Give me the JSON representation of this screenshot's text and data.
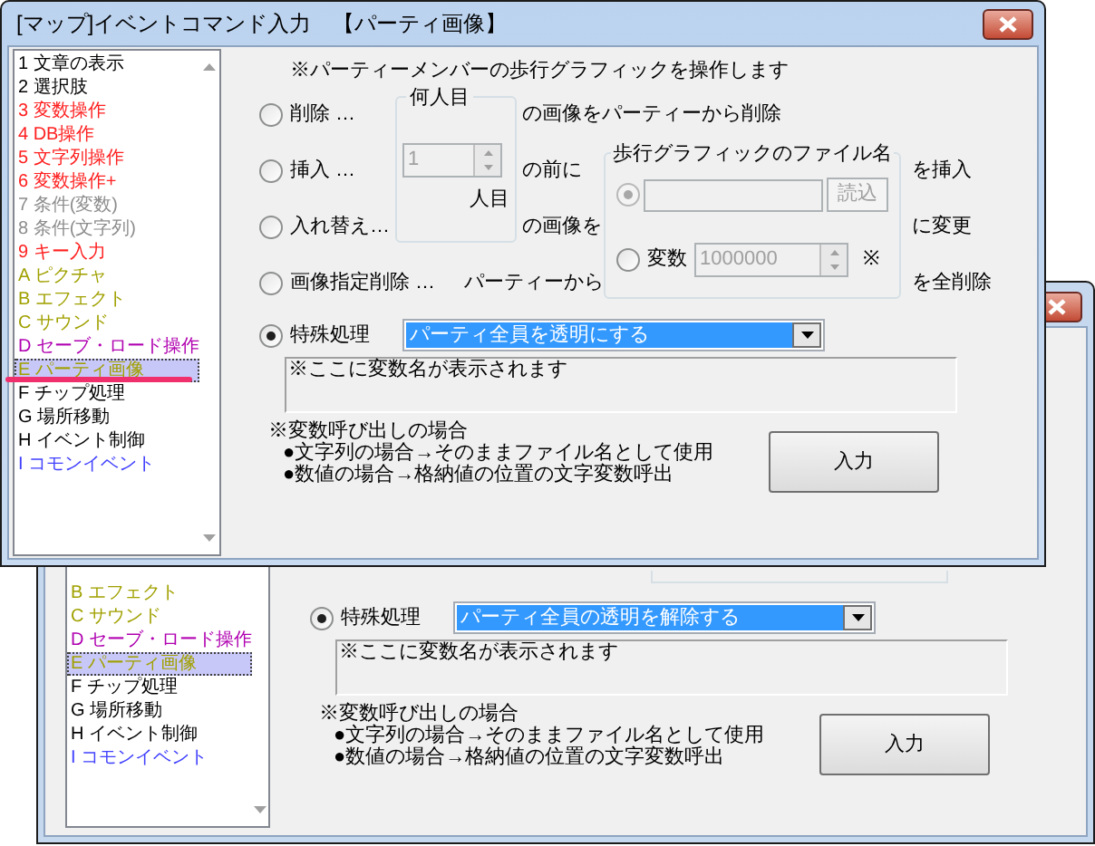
{
  "front_window": {
    "title": "[マップ]イベントコマンド入力　【パーティ画像】",
    "command_list": [
      {
        "label": "1 文章の表示",
        "color": "#000000",
        "selected": false
      },
      {
        "label": "2 選択肢",
        "color": "#000000",
        "selected": false
      },
      {
        "label": "3 変数操作",
        "color": "#ff2020",
        "selected": false
      },
      {
        "label": "4 DB操作",
        "color": "#ff2020",
        "selected": false
      },
      {
        "label": "5 文字列操作",
        "color": "#ff2020",
        "selected": false
      },
      {
        "label": "6 変数操作+",
        "color": "#ff2020",
        "selected": false
      },
      {
        "label": "7 条件(変数)",
        "color": "#8c8c8c",
        "selected": false
      },
      {
        "label": "8 条件(文字列)",
        "color": "#8c8c8c",
        "selected": false
      },
      {
        "label": "9 キー入力",
        "color": "#ff2020",
        "selected": false
      },
      {
        "label": "A ピクチャ",
        "color": "#a0a000",
        "selected": false
      },
      {
        "label": "B エフェクト",
        "color": "#a0a000",
        "selected": false
      },
      {
        "label": "C サウンド",
        "color": "#a0a000",
        "selected": false
      },
      {
        "label": "D セーブ・ロード操作",
        "color": "#b000b0",
        "selected": false
      },
      {
        "label": "E パーティ画像",
        "color": "#a0a000",
        "selected": true
      },
      {
        "label": "F チップ処理",
        "color": "#000000",
        "selected": false
      },
      {
        "label": "G 場所移動",
        "color": "#000000",
        "selected": false
      },
      {
        "label": "H イベント制御",
        "color": "#000000",
        "selected": false
      },
      {
        "label": "I コモンイベント",
        "color": "#4040ff",
        "selected": false
      }
    ],
    "description": "※パーティーメンバーの歩行グラフィックを操作します",
    "operations": [
      {
        "label": "削除 …",
        "selected": false,
        "suffix": "の画像をパーティーから削除"
      },
      {
        "label": "挿入 …",
        "selected": false,
        "suffix": "の前に",
        "result": "を挿入"
      },
      {
        "label": "入れ替え…",
        "selected": false,
        "suffix": "の画像を",
        "result": "に変更"
      },
      {
        "label": "画像指定削除 …",
        "selected": false,
        "suffix": "パーティーから",
        "result": "を全削除"
      }
    ],
    "member_group": {
      "title": "何人目",
      "value": "1",
      "unit": "人目",
      "disabled": true
    },
    "file_group": {
      "title": "歩行グラフィックのファイル名",
      "file_option": {
        "selected": true,
        "disabled": true,
        "button": "読込"
      },
      "variable_option": {
        "selected": false,
        "disabled": true,
        "label": "変数",
        "value": "1000000",
        "mark": "※"
      }
    },
    "special": {
      "label": "特殊処理",
      "selected": true,
      "select_value": "パーティ全員を透明にする"
    },
    "variable_note": "※ここに変数名が表示されます",
    "notes": [
      "※変数呼び出しの場合",
      "●文字列の場合→そのままファイル名として使用",
      "●数値の場合→格納値の位置の文字変数呼出"
    ],
    "submit_button": "入力"
  },
  "back_window": {
    "command_list": [
      {
        "label": "B エフェクト",
        "color": "#a0a000",
        "selected": false
      },
      {
        "label": "C サウンド",
        "color": "#a0a000",
        "selected": false
      },
      {
        "label": "D セーブ・ロード操作",
        "color": "#b000b0",
        "selected": false
      },
      {
        "label": "E パーティ画像",
        "color": "#a0a000",
        "selected": true
      },
      {
        "label": "F チップ処理",
        "color": "#000000",
        "selected": false
      },
      {
        "label": "G 場所移動",
        "color": "#000000",
        "selected": false
      },
      {
        "label": "H イベント制御",
        "color": "#000000",
        "selected": false
      },
      {
        "label": "I コモンイベント",
        "color": "#4040ff",
        "selected": false
      }
    ],
    "special": {
      "label": "特殊処理",
      "selected": true,
      "select_value": "パーティ全員の透明を解除する"
    },
    "variable_note": "※ここに変数名が表示されます",
    "notes": [
      "※変数呼び出しの場合",
      "●文字列の場合→そのままファイル名として使用",
      "●数値の場合→格納値の位置の文字変数呼出"
    ],
    "submit_button": "入力"
  }
}
